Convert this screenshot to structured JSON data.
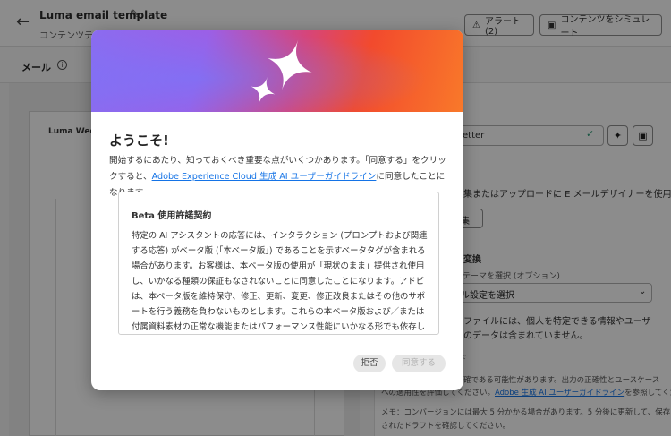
{
  "app": {
    "title": "Luma email template",
    "subtitle": "コンテンツテ",
    "alert_button": "アラート(2)",
    "simulate_button": "コンテンツをシミュレート"
  },
  "section": {
    "title": "メール"
  },
  "preview": {
    "label": "Luma Week"
  },
  "right_panel": {
    "field_value": "etter",
    "desc": "編集またはアップロードに E メールデザイナーを使用",
    "small_button": "集",
    "convert_title": "に変換",
    "theme_label": "ドテーマを選択 (オプション)",
    "select_value": "ル設定を選択",
    "note1": "たファイルには、個人を特定できる情報やユーザ",
    "note2": "他のデータは含まれていません。",
    "btn_ghost": "ド",
    "disclaimer1": "確である可能性があります。出力の正確性とユースケース",
    "disclaimer2_prefix": "への適用性を評価してください。",
    "disclaimer2_link": "Adobe 生成 AI ユーザーガイドライン",
    "disclaimer2_suffix": "を参照してください。",
    "memo1": "メモ：コンバージョンには最大 5 分かかる場合があります。5 分後に更新して、保存",
    "memo2": "されたドラフトを確認してください。"
  },
  "modal": {
    "welcome": "ようこそ!",
    "intro_prefix": "開始するにあたり、知っておくべき重要な点がいくつかあります。「同意する」をクリックすると、",
    "intro_link": "Adobe Experience Cloud 生成 AI ユーザーガイドライン",
    "intro_suffix": "に同意したことになります。",
    "terms_title": "Beta 使用許諾契約",
    "terms_body": "特定の AI アシスタントの応答には、インタラクション (プロンプトおよび関連する応答) がベータ版 (「本ベータ版」) であることを示すベータタグが含まれる場合があります。お客様は、本ベータ版の使用が「現状のまま」提供され使用し、いかなる種類の保証もなされないことに同意したことになります。アドビは、本ベータ版を維持保守、修正、更新、変更、修正改良またはその他のサポートを行う義務を負わないものとします。これらの本ベータ版および／または付属資料素材の正常な機能またはパフォーマンス性能にいかなる形でも依存しないように注意してください。本ベータ版はアドビの機密情報と見なされま",
    "decline_button": "拒否",
    "agree_button": "同意する"
  },
  "colors": {
    "link": "#1473e6",
    "hero_start": "#8a6cf0",
    "hero_end": "#f9792a"
  }
}
